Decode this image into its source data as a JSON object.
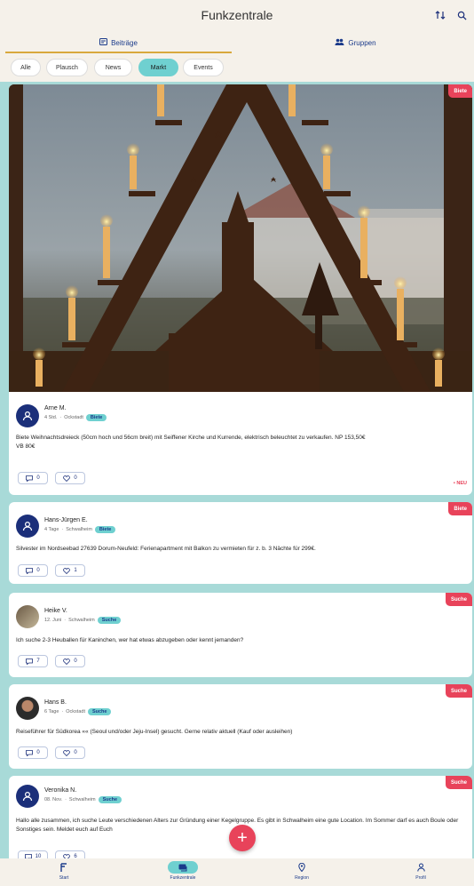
{
  "header": {
    "title": "Funkzentrale",
    "sort_icon": "sort-icon",
    "search_icon": "search-icon"
  },
  "tabs": [
    {
      "label": "Beiträge",
      "icon": "posts-icon"
    },
    {
      "label": "Gruppen",
      "icon": "groups-icon"
    }
  ],
  "filters": [
    "Alle",
    "Plausch",
    "News",
    "Markt",
    "Events"
  ],
  "active_filter": "Markt",
  "posts": [
    {
      "badge": "Biete",
      "author": "Arne M.",
      "time": "4 Std.",
      "location": "Ockstadt",
      "tag": "Biete",
      "text": "Biete Weihnachtsdreieck (50cm hoch und 56cm breit) mit Seiffener Kirche und Kurrende, elektrisch beleuchtet zu verkaufen. NP 153,50€",
      "text2": "VB 80€",
      "comments": "0",
      "likes": "0",
      "new_label": "• NEU"
    },
    {
      "badge": "Biete",
      "author": "Hans-Jürgen E.",
      "time": "4 Tage",
      "location": "Schwalheim",
      "tag": "Biete",
      "text": "Silvester im Nordseebad 27639 Dorum-Neufeld: Ferienapartment mit Balkon zu vermieten für z. b. 3 Nächte für 299€.",
      "comments": "0",
      "likes": "1"
    },
    {
      "badge": "Suche",
      "author": "Heike V.",
      "time": "12. Juni",
      "location": "Schwalheim",
      "tag": "Suche",
      "text": "Ich suche 2-3 Heuballen für Kaninchen, wer hat etwas abzugeben oder kennt jemanden?",
      "comments": "7",
      "likes": "0"
    },
    {
      "badge": "Suche",
      "author": "Hans B.",
      "time": "6 Tage",
      "location": "Ockstadt",
      "tag": "Suche",
      "text": "Reiseführer für Südkorea «« (Seoul und/oder Jeju-Insel) gesucht. Gerne relativ aktuell (Kauf oder ausleihen)",
      "comments": "0",
      "likes": "0"
    },
    {
      "badge": "Suche",
      "author": "Veronika N.",
      "time": "08. Nov.",
      "location": "Schwalheim",
      "tag": "Suche",
      "text": "Hallo alle zusammen, ich suche Leute verschiedenen Alters zur Gründung einer Kegelgruppe. Es gibt in Schwalheim eine gute Location. Im Sommer darf es auch Boule oder Sonstiges sein. Meldet euch auf Euch",
      "comments": "10",
      "likes": "6"
    }
  ],
  "fab": "+",
  "nav": [
    {
      "label": "Start",
      "icon": "home-icon"
    },
    {
      "label": "Funkzentrale",
      "icon": "chat-icon"
    },
    {
      "label": "Region",
      "icon": "location-pin-icon"
    },
    {
      "label": "Profil",
      "icon": "profile-icon"
    }
  ],
  "colors": {
    "accent": "#6fd0d0",
    "badge": "#e8435a",
    "navy": "#1b2f7a",
    "background": "#a8dad8",
    "header": "#f5f1ea",
    "tab_underline": "#d9a83d"
  }
}
